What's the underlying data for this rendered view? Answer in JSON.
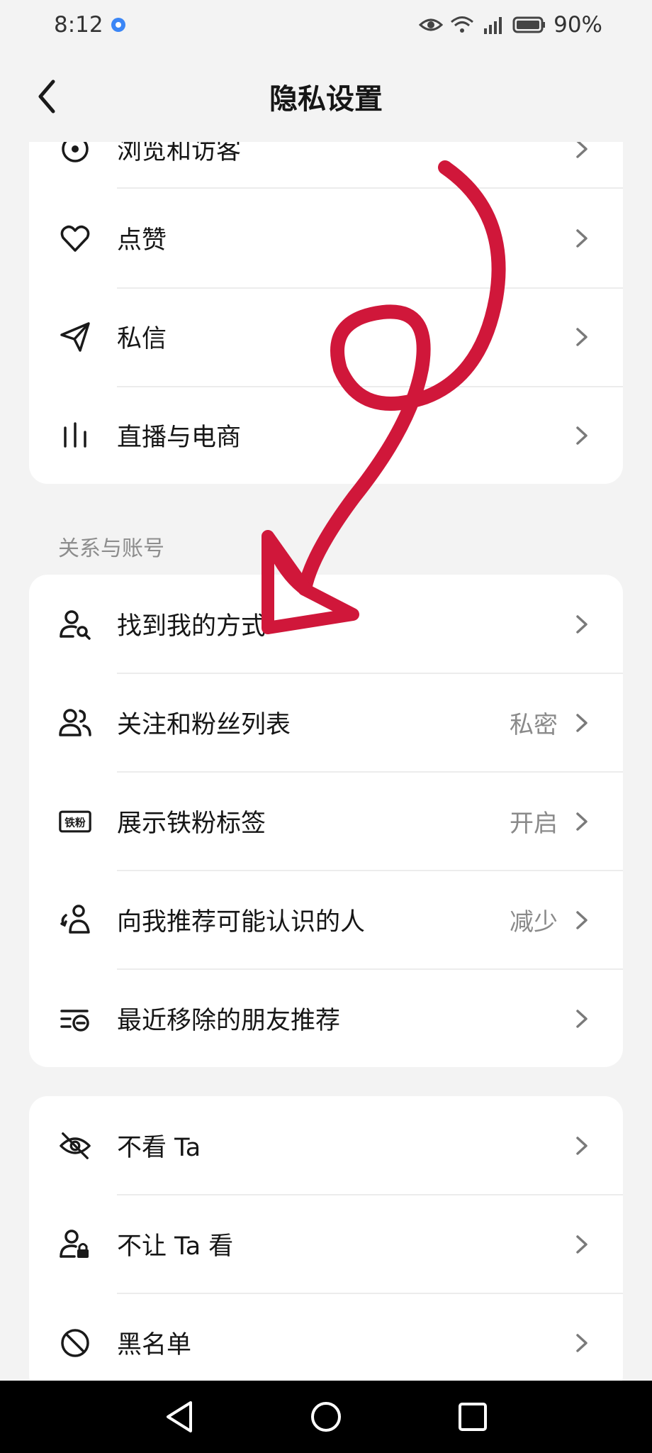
{
  "status_bar": {
    "time": "8:12",
    "battery": "90%"
  },
  "header": {
    "title": "隐私设置"
  },
  "top_group": [
    {
      "label": "浏览和访客",
      "icon": "eye-icon"
    },
    {
      "label": "点赞",
      "icon": "heart-icon"
    },
    {
      "label": "私信",
      "icon": "send-icon"
    },
    {
      "label": "直播与电商",
      "icon": "bars-icon"
    }
  ],
  "relations_section": {
    "title": "关系与账号",
    "items": [
      {
        "label": "找到我的方式",
        "value": "",
        "icon": "person-search-icon"
      },
      {
        "label": "关注和粉丝列表",
        "value": "私密",
        "icon": "people-icon"
      },
      {
        "label": "展示铁粉标签",
        "value": "开启",
        "icon": "badge-icon",
        "badge_text": "铁粉"
      },
      {
        "label": "向我推荐可能认识的人",
        "value": "减少",
        "icon": "person-connect-icon"
      },
      {
        "label": "最近移除的朋友推荐",
        "value": "",
        "icon": "list-remove-icon"
      }
    ]
  },
  "block_group": [
    {
      "label": "不看 Ta",
      "icon": "eye-off-icon"
    },
    {
      "label": "不让 Ta 看",
      "icon": "person-lock-icon"
    },
    {
      "label": "黑名单",
      "icon": "block-icon"
    }
  ],
  "annotation": {
    "color": "#d0173a"
  },
  "nav": {
    "back": "back-icon",
    "home": "home-icon",
    "recent": "recent-icon"
  }
}
